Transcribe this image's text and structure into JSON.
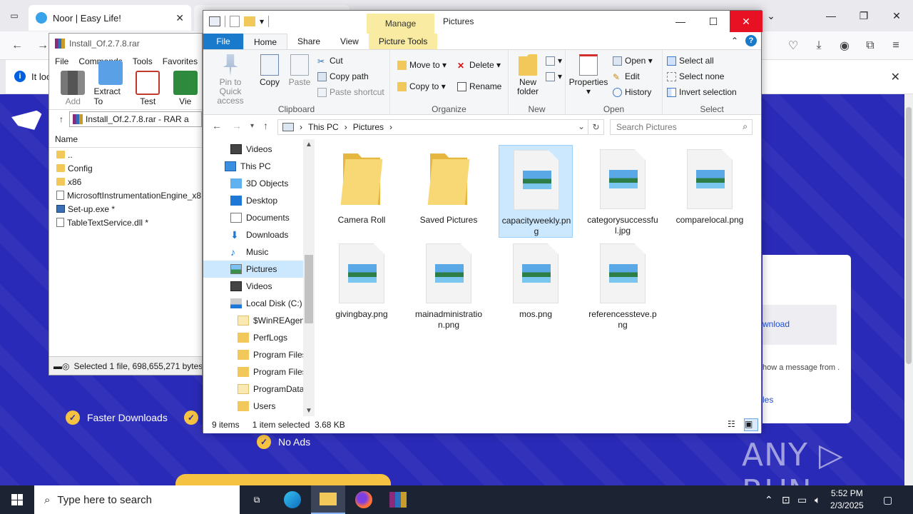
{
  "browser": {
    "tab_title": "Noor | Easy Life!",
    "infobar_text": "It loo",
    "features": [
      "Faster Downloads",
      "No Ads"
    ],
    "download_card": {
      "button_label": "wnload",
      "message": "how a message from\n.",
      "link": "les"
    },
    "watermark": "ANY ▷ RUN"
  },
  "winrar": {
    "title": "Install_Of.2.7.8.rar",
    "menu": [
      "File",
      "Commands",
      "Tools",
      "Favorites"
    ],
    "tools": [
      "Add",
      "Extract To",
      "Test",
      "Vie"
    ],
    "address": "Install_Of.2.7.8.rar - RAR a",
    "column_name": "Name",
    "rows": [
      "..",
      "Config",
      "x86",
      "MicrosoftInstrumentationEngine_x8",
      "Set-up.exe *",
      "TableTextService.dll *"
    ],
    "status": "Selected 1 file, 698,655,271 bytes"
  },
  "explorer": {
    "manage_tab": "Manage",
    "title": "Pictures",
    "tabs": {
      "file": "File",
      "home": "Home",
      "share": "Share",
      "view": "View",
      "picture_tools": "Picture Tools"
    },
    "ribbon": {
      "clipboard": {
        "label": "Clipboard",
        "pin": "Pin to Quick access",
        "copy": "Copy",
        "paste": "Paste",
        "cut": "Cut",
        "copy_path": "Copy path",
        "paste_shortcut": "Paste shortcut"
      },
      "organize": {
        "label": "Organize",
        "move_to": "Move to ▾",
        "copy_to": "Copy to ▾",
        "delete": "Delete ▾",
        "rename": "Rename"
      },
      "new": {
        "label": "New",
        "new_folder": "New folder"
      },
      "open": {
        "label": "Open",
        "properties": "Properties",
        "open": "Open ▾",
        "edit": "Edit",
        "history": "History"
      },
      "select": {
        "label": "Select",
        "select_all": "Select all",
        "select_none": "Select none",
        "invert": "Invert selection"
      }
    },
    "breadcrumb": [
      "This PC",
      "Pictures"
    ],
    "search_placeholder": "Search Pictures",
    "nav": [
      {
        "label": "Videos",
        "icon": "video-icon"
      },
      {
        "label": "This PC",
        "icon": "pc-icon"
      },
      {
        "label": "3D Objects",
        "icon": "cube-icon"
      },
      {
        "label": "Desktop",
        "icon": "desktop-icon"
      },
      {
        "label": "Documents",
        "icon": "document-icon"
      },
      {
        "label": "Downloads",
        "icon": "download-icon"
      },
      {
        "label": "Music",
        "icon": "music-icon"
      },
      {
        "label": "Pictures",
        "icon": "picture-icon"
      },
      {
        "label": "Videos",
        "icon": "video-icon"
      },
      {
        "label": "Local Disk (C:)",
        "icon": "drive-icon"
      },
      {
        "label": "$WinREAgent",
        "icon": "folder-icon"
      },
      {
        "label": "PerfLogs",
        "icon": "folder-icon"
      },
      {
        "label": "Program Files",
        "icon": "folder-icon"
      },
      {
        "label": "Program Files",
        "icon": "folder-icon"
      },
      {
        "label": "ProgramData",
        "icon": "folder-icon"
      },
      {
        "label": "Users",
        "icon": "folder-icon"
      }
    ],
    "files": [
      {
        "name": "Camera Roll",
        "type": "folder"
      },
      {
        "name": "Saved Pictures",
        "type": "folder"
      },
      {
        "name": "capacityweekly.png",
        "type": "image"
      },
      {
        "name": "categorysuccessful.jpg",
        "type": "image"
      },
      {
        "name": "comparelocal.png",
        "type": "image"
      },
      {
        "name": "givingbay.png",
        "type": "image"
      },
      {
        "name": "mainadministration.png",
        "type": "image"
      },
      {
        "name": "mos.png",
        "type": "image"
      },
      {
        "name": "referencessteve.png",
        "type": "image"
      }
    ],
    "status": {
      "items": "9 items",
      "selected": "1 item selected",
      "size": "3.68 KB"
    }
  },
  "taskbar": {
    "search_placeholder": "Type here to search",
    "time": "5:52 PM",
    "date": "2/3/2025"
  }
}
